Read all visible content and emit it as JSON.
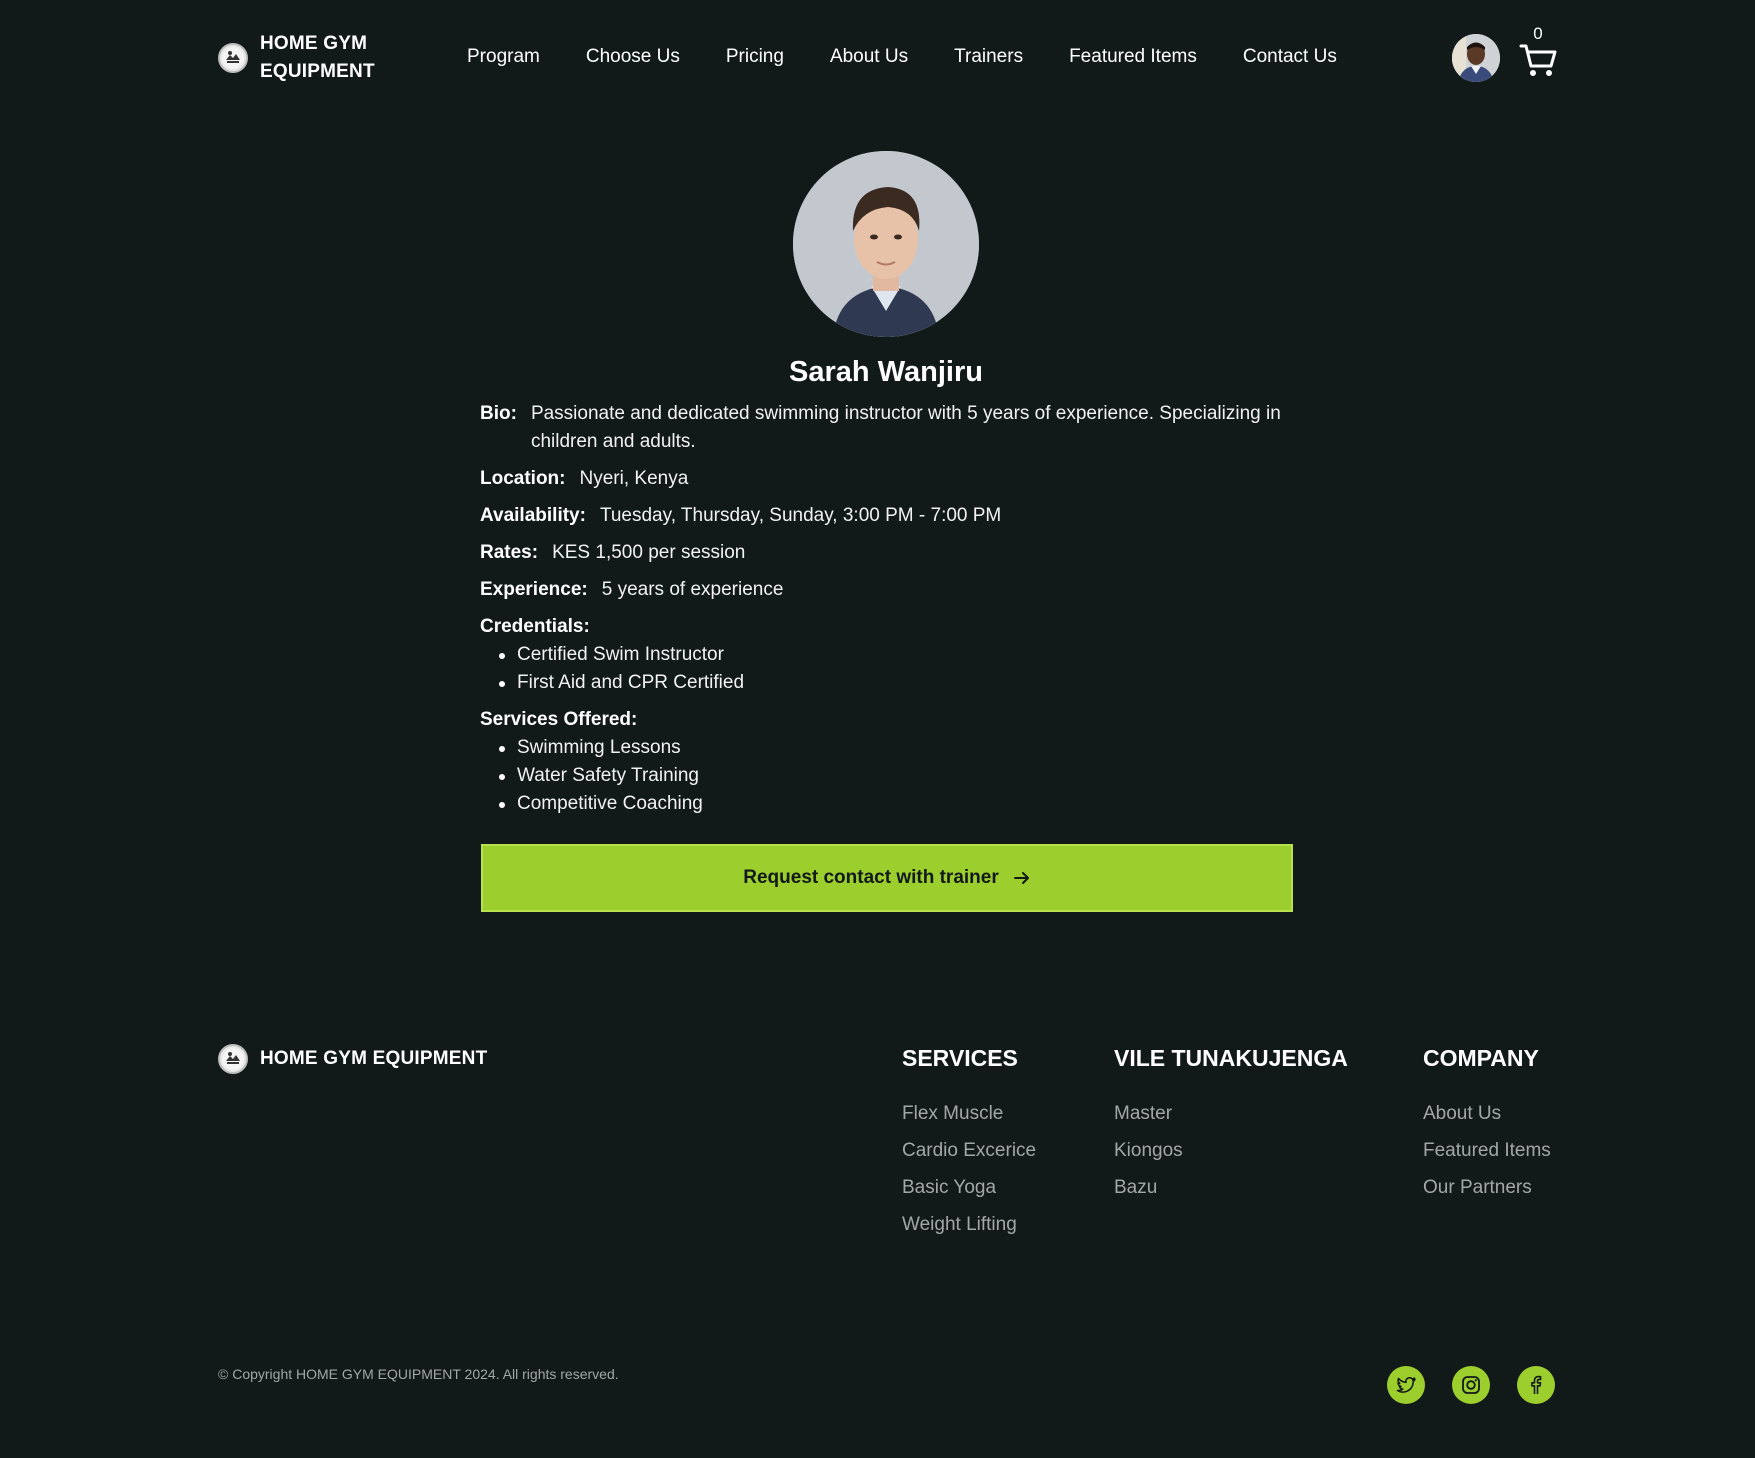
{
  "header": {
    "brand_name": "HOME GYM EQUIPMENT",
    "nav": [
      "Program",
      "Choose Us",
      "Pricing",
      "About Us",
      "Trainers",
      "Featured Items",
      "Contact Us"
    ],
    "cart_count": "0"
  },
  "trainer": {
    "name": "Sarah Wanjiru",
    "bio_label": "Bio:",
    "bio": "Passionate and dedicated swimming instructor with 5 years of experience. Specializing in children and adults.",
    "location_label": "Location:",
    "location": "Nyeri, Kenya",
    "availability_label": "Availability:",
    "availability": "Tuesday, Thursday, Sunday, 3:00 PM - 7:00 PM",
    "rates_label": "Rates:",
    "rates": "KES 1,500 per session",
    "experience_label": "Experience:",
    "experience": "5 years of experience",
    "credentials_label": "Credentials:",
    "credentials": [
      "Certified Swim Instructor",
      "First Aid and CPR Certified"
    ],
    "services_label": "Services Offered:",
    "services": [
      "Swimming Lessons",
      "Water Safety Training",
      "Competitive Coaching"
    ],
    "cta_label": "Request contact with trainer"
  },
  "footer": {
    "brand_name": "HOME GYM EQUIPMENT",
    "columns": [
      {
        "title": "SERVICES",
        "links": [
          "Flex Muscle",
          "Cardio Excerice",
          "Basic Yoga",
          "Weight Lifting"
        ]
      },
      {
        "title": "VILE TUNAKUJENGA",
        "links": [
          "Master",
          "Kiongos",
          "Bazu"
        ]
      },
      {
        "title": "COMPANY",
        "links": [
          "About Us",
          "Featured Items",
          "Our Partners"
        ]
      }
    ],
    "copyright": "© Copyright HOME GYM EQUIPMENT 2024. All rights reserved.",
    "socials": [
      "twitter-icon",
      "instagram-icon",
      "facebook-icon"
    ]
  },
  "colors": {
    "background": "#121919",
    "accent": "#9ccf2e",
    "muted_text": "#a3a7a8"
  }
}
